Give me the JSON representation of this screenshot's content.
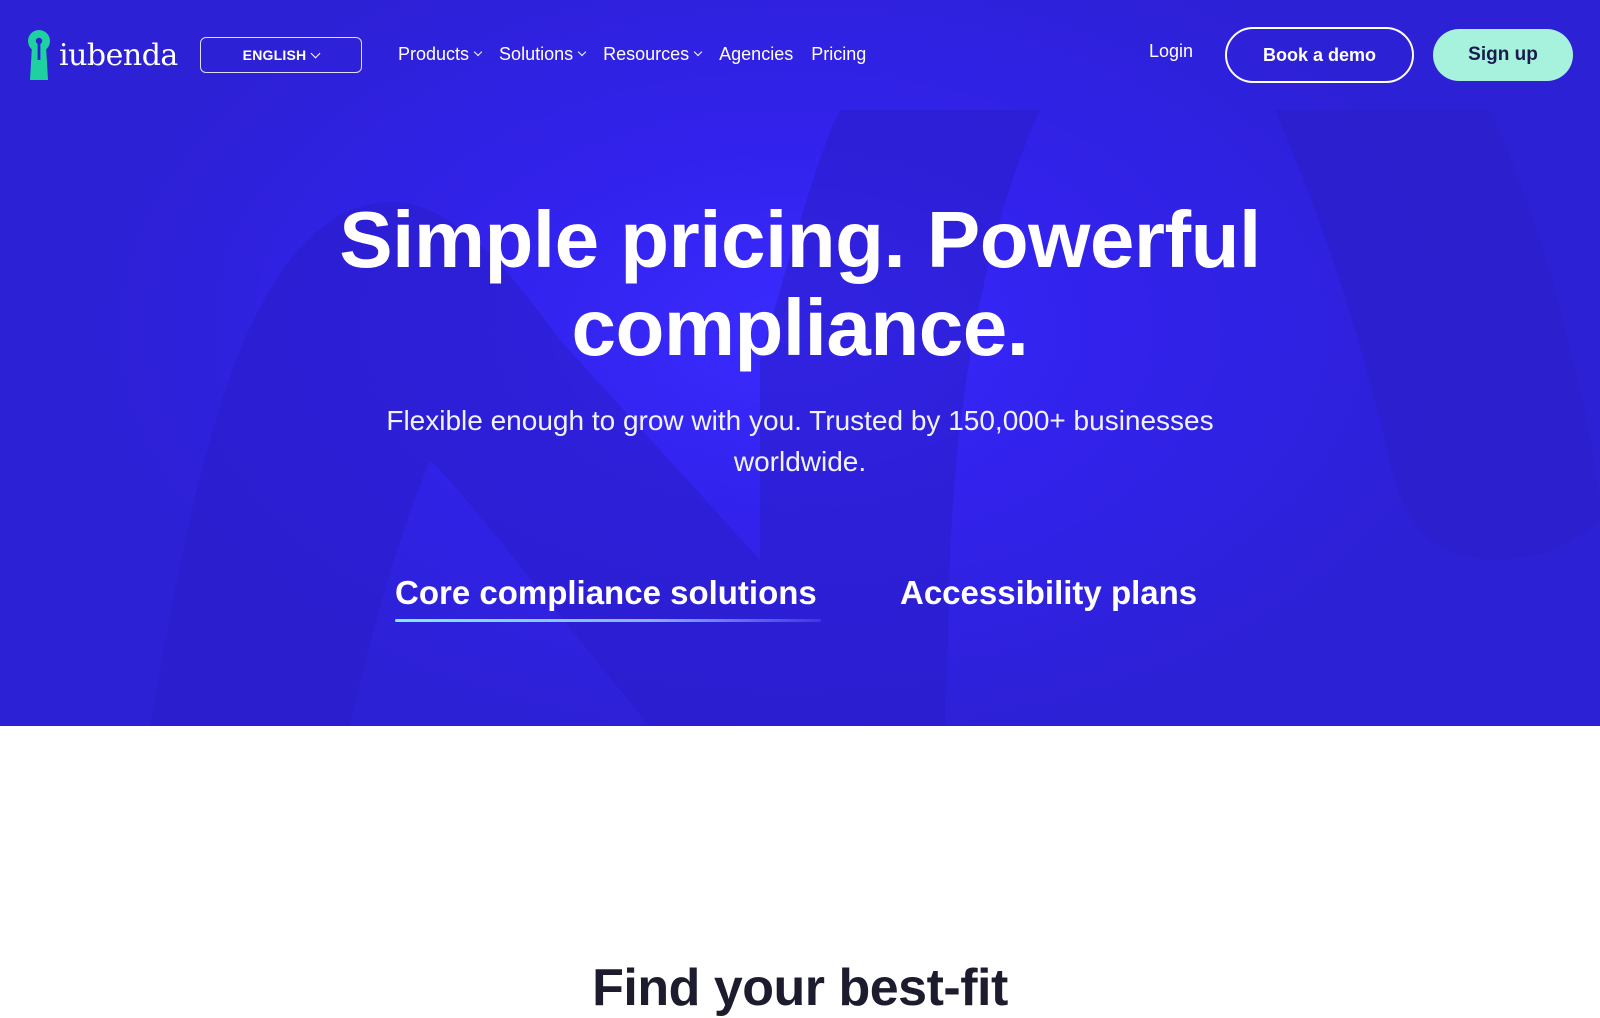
{
  "brand": {
    "name": "iubenda",
    "logo_color": "#1fd1a0"
  },
  "nav": {
    "language_label": "ENGLISH",
    "menu": [
      {
        "label": "Products",
        "dropdown": true
      },
      {
        "label": "Solutions",
        "dropdown": true
      },
      {
        "label": "Resources",
        "dropdown": true
      },
      {
        "label": "Agencies",
        "dropdown": false
      },
      {
        "label": "Pricing",
        "dropdown": false
      }
    ],
    "login_label": "Login",
    "demo_label": "Book a demo",
    "signup_label": "Sign up"
  },
  "hero": {
    "headline": "Simple pricing. Powerful compliance.",
    "subheadline": "Flexible enough to grow with you. Trusted by 150,000+ businesses worldwide.",
    "tabs": [
      {
        "label": "Core compliance solutions",
        "active": true
      },
      {
        "label": "Accessibility plans",
        "active": false
      }
    ],
    "background_color": "#3222ec"
  },
  "section": {
    "title": "Find your best-fit"
  },
  "colors": {
    "accent": "#a6f2dd",
    "hero": "#3222ec",
    "text_dark": "#1c1c2e"
  }
}
